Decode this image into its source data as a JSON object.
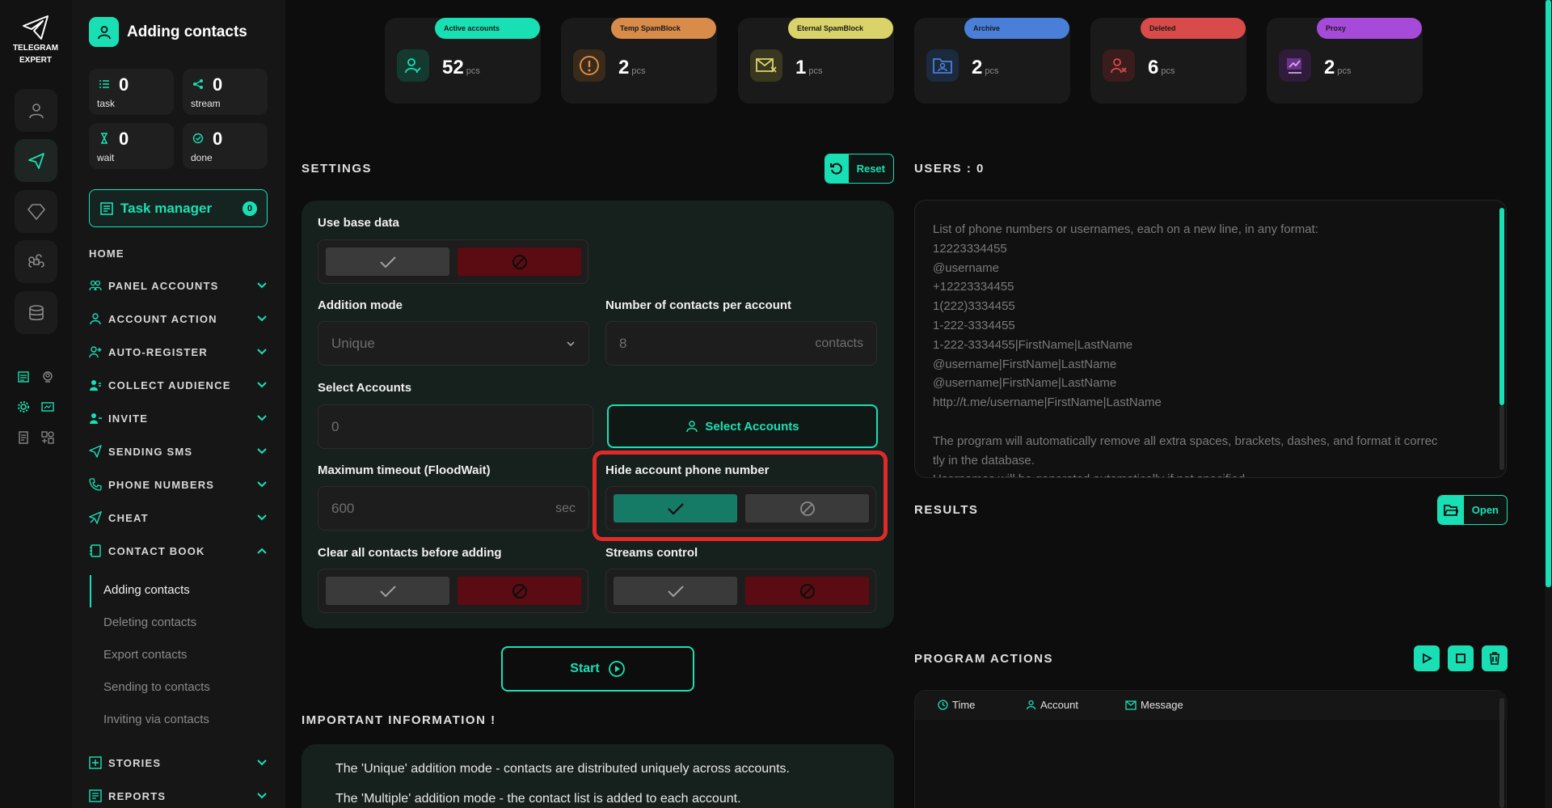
{
  "app": {
    "logo_text_1": "TELEGRAM",
    "logo_text_2": "EXPERT"
  },
  "sidebar": {
    "page_title": "Adding contacts",
    "stats": [
      {
        "value": "0",
        "label": "task"
      },
      {
        "value": "0",
        "label": "stream"
      },
      {
        "value": "0",
        "label": "wait"
      },
      {
        "value": "0",
        "label": "done"
      }
    ],
    "task_manager": {
      "label": "Task manager",
      "badge": "0"
    },
    "home": "HOME",
    "nav": [
      {
        "label": "PANEL ACCOUNTS",
        "icon": "users-icon"
      },
      {
        "label": "ACCOUNT ACTION",
        "icon": "user-icon"
      },
      {
        "label": "AUTO-REGISTER",
        "icon": "user-plus-icon"
      },
      {
        "label": "COLLECT AUDIENCE",
        "icon": "audience-icon"
      },
      {
        "label": "INVITE",
        "icon": "invite-icon"
      },
      {
        "label": "SENDING SMS",
        "icon": "send-icon"
      },
      {
        "label": "PHONE NUMBERS",
        "icon": "phone-icon"
      },
      {
        "label": "CHEAT",
        "icon": "cheat-icon"
      },
      {
        "label": "CONTACT BOOK",
        "icon": "contact-book-icon"
      }
    ],
    "contact_book_items": [
      "Adding contacts",
      "Deleting contacts",
      "Export contacts",
      "Sending to contacts",
      "Inviting via contacts"
    ],
    "nav_bottom": [
      {
        "label": "STORIES",
        "icon": "stories-icon"
      },
      {
        "label": "REPORTS",
        "icon": "reports-icon"
      }
    ]
  },
  "counters": [
    {
      "tag": "Active accounts",
      "value": "52",
      "unit": "pcs",
      "color": "#19e0b4",
      "icon": "active-user-icon"
    },
    {
      "tag": "Temp SpamBlock",
      "value": "2",
      "unit": "pcs",
      "color": "#d98b4a",
      "icon": "warning-icon"
    },
    {
      "tag": "Eternal SpamBlock",
      "value": "1",
      "unit": "pcs",
      "color": "#d9d36a",
      "icon": "mail-blocked-icon"
    },
    {
      "tag": "Archive",
      "value": "2",
      "unit": "pcs",
      "color": "#4a7fd9",
      "icon": "archive-icon"
    },
    {
      "tag": "Deleted",
      "value": "6",
      "unit": "pcs",
      "color": "#d94a4a",
      "icon": "deleted-user-icon"
    },
    {
      "tag": "Proxy",
      "value": "2",
      "unit": "pcs",
      "color": "#a64ad9",
      "icon": "proxy-icon"
    }
  ],
  "settings": {
    "title": "SETTINGS",
    "reset_label": "Reset",
    "use_base_data": "Use base data",
    "addition_mode_label": "Addition mode",
    "addition_mode_value": "Unique",
    "contacts_per_account_label": "Number of contacts per account",
    "contacts_per_account_value": "8",
    "contacts_unit": "contacts",
    "select_accounts_label": "Select Accounts",
    "select_accounts_value": "0",
    "select_accounts_button": "Select Accounts",
    "max_timeout_label": "Maximum timeout (FloodWait)",
    "max_timeout_value": "600",
    "timeout_unit": "sec",
    "hide_phone_label": "Hide account phone number",
    "clear_contacts_label": "Clear all contacts before adding",
    "streams_control_label": "Streams control",
    "start_label": "Start"
  },
  "info": {
    "title": "IMPORTANT INFORMATION !",
    "lines": [
      "The 'Unique' addition mode - contacts are distributed uniquely across accounts.",
      "The 'Multiple' addition mode - the contact list is added to each account."
    ]
  },
  "users": {
    "title": "USERS : 0",
    "placeholder": "List of phone numbers or usernames, each on a new line, in any format:\n12223334455\n@username\n+12223334455\n1(222)3334455\n1-222-3334455\n1-222-3334455|FirstName|LastName\n@username|FirstName|LastName\n@username|FirstName|LastName\nhttp://t.me/username|FirstName|LastName\n\nThe program will automatically remove all extra spaces, brackets, dashes, and format it correc\ntly in the database.\nUsernames will be generated automatically if not specified"
  },
  "results": {
    "title": "RESULTS",
    "open_label": "Open"
  },
  "program_actions": {
    "title": "PROGRAM ACTIONS",
    "columns": [
      "Time",
      "Account",
      "Message"
    ]
  }
}
